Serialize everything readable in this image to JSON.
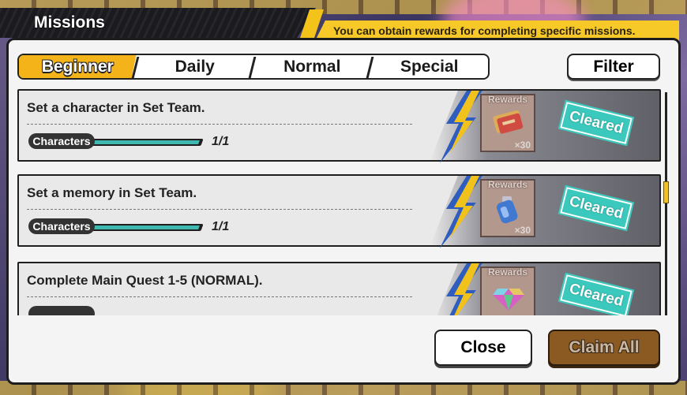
{
  "header": {
    "title": "Missions",
    "subtitle": "You can obtain rewards for completing specific missions."
  },
  "tabs": [
    {
      "label": "Beginner",
      "active": true
    },
    {
      "label": "Daily",
      "active": false
    },
    {
      "label": "Normal",
      "active": false
    },
    {
      "label": "Special",
      "active": false
    }
  ],
  "filter_label": "Filter",
  "missions": [
    {
      "text": "Set a character in Set Team.",
      "category": "Characters",
      "progress": "1/1",
      "progress_fraction": 1.0,
      "reward_label": "Rewards",
      "reward_icon": "ticket-icon",
      "reward_qty": "×30",
      "status": "Cleared"
    },
    {
      "text": "Set a memory in Set Team.",
      "category": "Characters",
      "progress": "1/1",
      "progress_fraction": 1.0,
      "reward_label": "Rewards",
      "reward_icon": "potion-icon",
      "reward_qty": "×30",
      "status": "Cleared"
    },
    {
      "text": "Complete Main Quest 1-5 (NORMAL).",
      "category": "",
      "progress": "",
      "reward_label": "Rewards",
      "reward_icon": "gem-icon",
      "reward_qty": "",
      "status": "Cleared"
    }
  ],
  "buttons": {
    "close": "Close",
    "claim_all": "Claim All"
  },
  "colors": {
    "tab_active": "#f4b319",
    "header_banner": "#f7c928",
    "cleared_stamp": "#3cc9bd",
    "progress_fill": "#3fb9b0",
    "claim_all_disabled": "#8a5a22"
  }
}
